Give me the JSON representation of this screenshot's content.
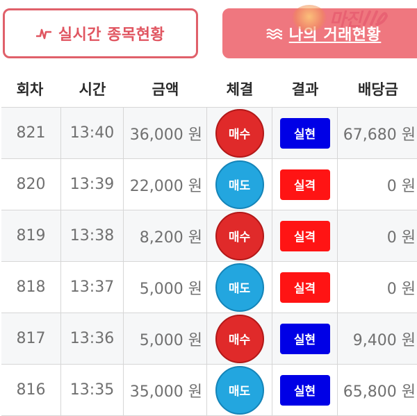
{
  "tabs": {
    "realtime": {
      "label": "실시간 종목현황",
      "icon": "pulse-icon",
      "color": "#e05560"
    },
    "my_trades": {
      "label": "나의 거래현황",
      "icon": "wave-lines-icon",
      "color": "#ef777f"
    }
  },
  "watermark": {
    "text": "마진",
    "subtext": ""
  },
  "table": {
    "headers": {
      "round": "회차",
      "time": "시간",
      "amount": "금액",
      "trade": "체결",
      "result": "결과",
      "payout": "배당금"
    },
    "rows": [
      {
        "round": "821",
        "time": "13:40",
        "amount": "36,000 원",
        "trade": "매수",
        "trade_type": "buy",
        "result": "실현",
        "result_type": "win",
        "payout": "67,680 원"
      },
      {
        "round": "820",
        "time": "13:39",
        "amount": "22,000 원",
        "trade": "매도",
        "trade_type": "sell",
        "result": "실격",
        "result_type": "lose",
        "payout": "0 원"
      },
      {
        "round": "819",
        "time": "13:38",
        "amount": "8,200 원",
        "trade": "매수",
        "trade_type": "buy",
        "result": "실격",
        "result_type": "lose",
        "payout": "0 원"
      },
      {
        "round": "818",
        "time": "13:37",
        "amount": "5,000 원",
        "trade": "매도",
        "trade_type": "sell",
        "result": "실격",
        "result_type": "lose",
        "payout": "0 원"
      },
      {
        "round": "817",
        "time": "13:36",
        "amount": "5,000 원",
        "trade": "매수",
        "trade_type": "buy",
        "result": "실현",
        "result_type": "win",
        "payout": "9,400 원"
      },
      {
        "round": "816",
        "time": "13:35",
        "amount": "35,000 원",
        "trade": "매도",
        "trade_type": "sell",
        "result": "실현",
        "result_type": "win",
        "payout": "65,800 원"
      }
    ]
  },
  "colors": {
    "buy": "#e02a2a",
    "sell": "#23a6df",
    "win": "#0000e6",
    "lose": "#ff1414"
  }
}
